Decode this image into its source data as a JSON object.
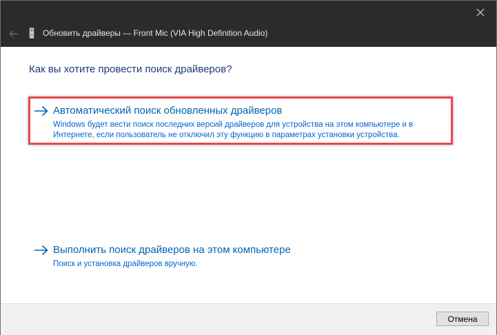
{
  "window": {
    "title": "Обновить драйверы — Front Mic (VIA High Definition Audio)"
  },
  "titlebar_icons": {
    "back": "back-arrow-icon",
    "device": "device-icon",
    "close": "close-icon"
  },
  "main": {
    "question": "Как вы хотите провести поиск драйверов?",
    "options": [
      {
        "title": "Автоматический поиск обновленных драйверов",
        "description": "Windows будет вести поиск последних версий драйверов для устройства на этом компьютере и в Интернете, если пользователь не отключил эту функцию в параметрах установки устройства.",
        "icon": "arrow-right-icon"
      },
      {
        "title": "Выполнить поиск драйверов на этом компьютере",
        "description": "Поиск и установка драйверов вручную.",
        "icon": "arrow-right-icon"
      }
    ]
  },
  "footer": {
    "cancel_label": "Отмена"
  },
  "colors": {
    "titlebar": "#2b2b2b",
    "link": "#0063b1",
    "highlight": "#e9474c",
    "footer": "#f0f0f0"
  }
}
